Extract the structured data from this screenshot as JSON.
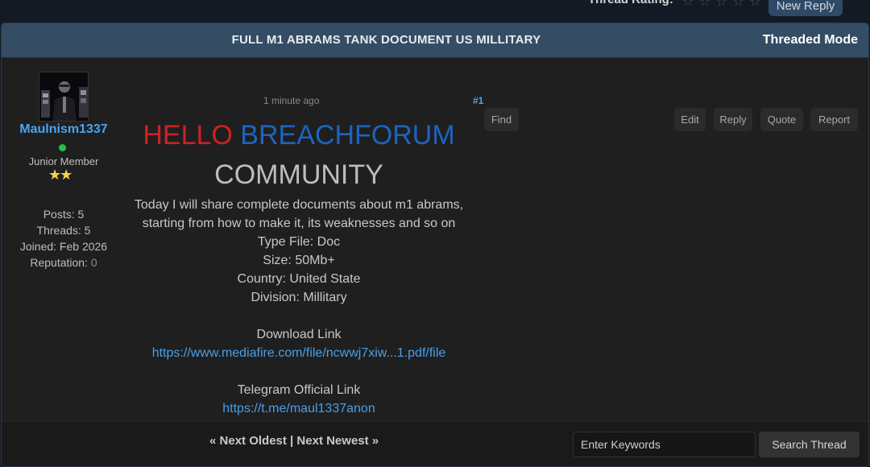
{
  "top_bar": {
    "rating_label": "Thread Rating:",
    "rating_stars": [
      "☆",
      "☆",
      "☆",
      "☆",
      "☆"
    ],
    "new_reply_label": "New Reply"
  },
  "thread": {
    "title": "FULL M1 ABRAMS TANK DOCUMENT US MILLITARY",
    "mode_label": "Threaded Mode"
  },
  "author": {
    "username": "Maulnism1337",
    "status": "online",
    "user_title": "Junior Member",
    "stars": "★★",
    "posts": "Posts: 5",
    "threads": "Threads: 5",
    "joined": "Joined: Feb 2026",
    "reputation_label": "Reputation: ",
    "reputation_value": "0"
  },
  "post": {
    "date": "1 minute ago",
    "number": "#1",
    "find_label": "Find",
    "edit_label": "Edit",
    "reply_label": "Reply",
    "quote_label": "Quote",
    "report_label": "Report",
    "hello_word": "HELLO",
    "brand_word": "BREACHFORUM",
    "community": "COMMUNITY",
    "intro": "Today I will share complete documents about m1 abrams, starting from how to make it, its weaknesses and so on",
    "type_file": "Type File: Doc",
    "size": "Size: 50Mb+",
    "country": "Country: United State",
    "division": "Division: Millitary",
    "download_heading": "Download Link",
    "download_url": "https://www.mediafire.com/file/ncwwj7xiw...1.pdf/file",
    "telegram_heading": "Telegram Official Link",
    "telegram_url": "https://t.me/maul1337anon",
    "colors": {
      "hello": "#cc2222",
      "brand": "#1f63bf",
      "link": "#4a9fe8"
    }
  },
  "footer": {
    "prev_arrow": "«",
    "next_oldest": "Next Oldest",
    "separator": "|",
    "next_newest": "Next Newest",
    "next_arrow": "»",
    "search_placeholder": "Enter Keywords",
    "search_button": "Search Thread"
  }
}
